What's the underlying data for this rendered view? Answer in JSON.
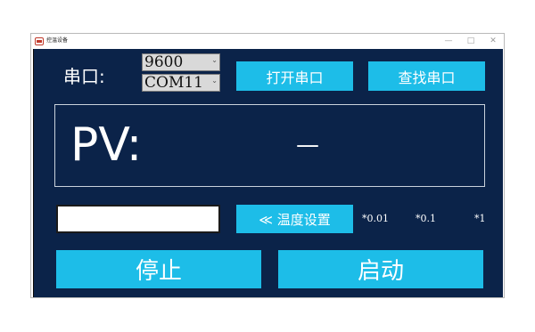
{
  "window": {
    "title": "控温设备",
    "minimize": "—",
    "maximize": "□",
    "close": "✕"
  },
  "serial": {
    "label": "串口:",
    "baud_value": "9600",
    "port_value": "COM11",
    "open_button": "打开串口",
    "find_button": "查找串口"
  },
  "pv": {
    "label": "PV:",
    "value": "—"
  },
  "temperature": {
    "input_value": "",
    "set_button": "≪ 温度设置",
    "step_001": "*0.01",
    "step_01": "*0.1",
    "step_1": "*1"
  },
  "controls": {
    "stop_button": "停止",
    "start_button": "启动"
  },
  "colors": {
    "panel_bg": "#0b2349",
    "button_bg": "#1dbde8",
    "text": "#ffffff"
  }
}
